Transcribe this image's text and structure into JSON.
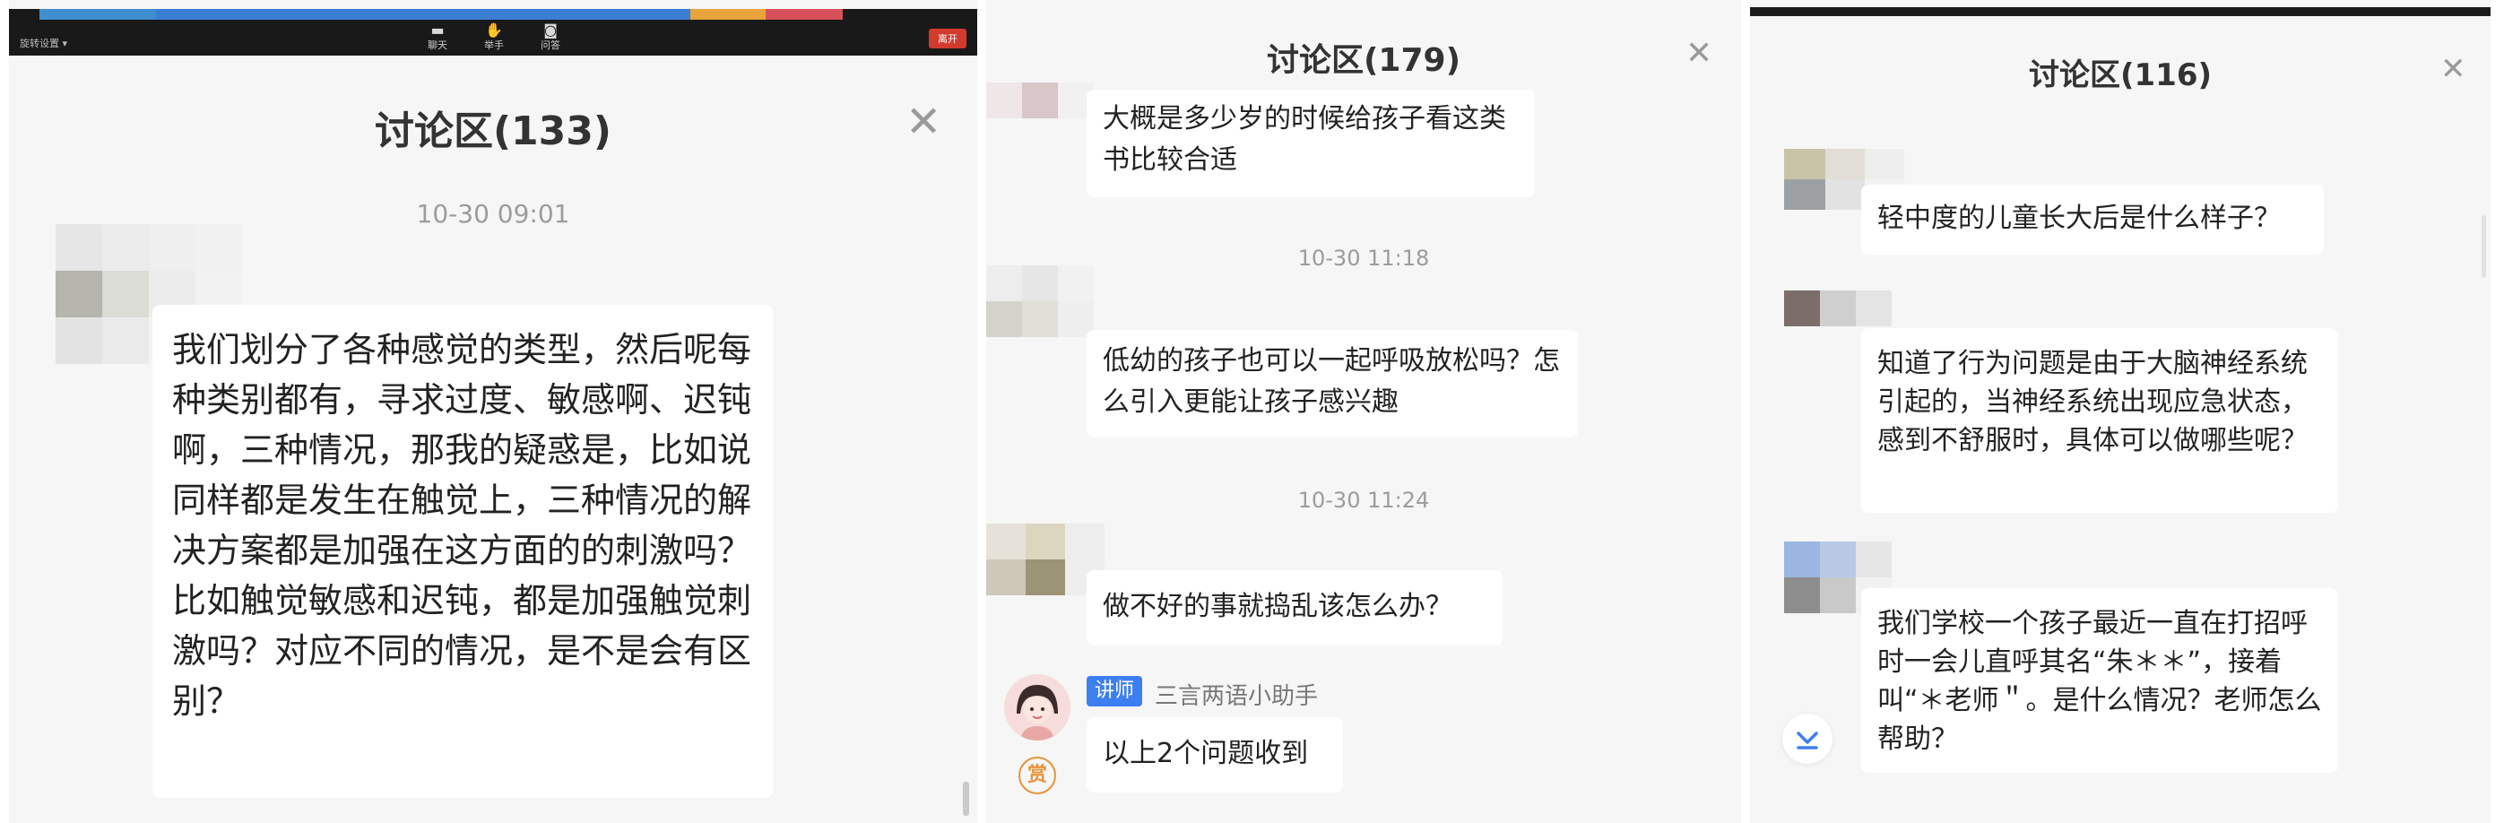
{
  "panel1": {
    "toolbar": {
      "settings_label": "旋转设置",
      "items": [
        {
          "label": "聊天",
          "icon": "chat-icon"
        },
        {
          "label": "举手",
          "icon": "hand-icon"
        },
        {
          "label": "问答",
          "icon": "qa-icon"
        }
      ],
      "leave_label": "离开"
    },
    "title": "讨论区(133)",
    "timestamp": "10-30 09:01",
    "message": "我们划分了各种感觉的类型，然后呢每种类别都有，寻求过度、敏感啊、迟钝啊，三种情况，那我的疑惑是，比如说同样都是发生在触觉上，三种情况的解决方案都是加强在这方面的的刺激吗？比如触觉敏感和迟钝，都是加强触觉刺激吗？对应不同的情况，是不是会有区别？"
  },
  "panel2": {
    "title": "讨论区(179)",
    "message1": "大概是多少岁的时候给孩子看这类书比较合适",
    "timestamp1": "10-30 11:18",
    "message2": "低幼的孩子也可以一起呼吸放松吗？怎么引入更能让孩子感兴趣",
    "timestamp2": "10-30 11:24",
    "message3": "做不好的事就捣乱该怎么办？",
    "teacher_tag": "讲师",
    "teacher_name": "三言两语小助手",
    "teacher_message": "以上2个问题收到",
    "reward_label": "赏"
  },
  "panel3": {
    "title": "讨论区(116)",
    "message1": "轻中度的儿童长大后是什么样子？",
    "message2": "知道了行为问题是由于大脑神经系统引起的，当神经系统出现应急状态，感到不舒服时，具体可以做哪些呢？",
    "message3": "我们学校一个孩子最近一直在打招呼时一会儿直呼其名“朱＊＊”，接着叫“＊老师＂。是什么情况？老师怎么帮助？"
  },
  "icons": {
    "close": "close-icon",
    "scroll_down": "scroll-down-icon"
  },
  "colors": {
    "background": "#f6f6f7",
    "bubble": "#ffffff",
    "teacher_tag": "#3d7ff0",
    "leave_button": "#d23a2e",
    "reward": "#e5933a"
  }
}
